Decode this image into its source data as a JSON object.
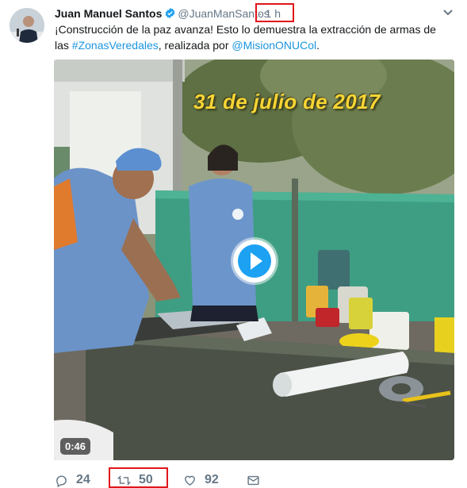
{
  "author": {
    "name": "Juan Manuel Santos",
    "handle": "@JuanManSantos",
    "time": "· 1 h"
  },
  "tweet": {
    "text_part1": "¡Construcción de la paz avanza! Esto lo demuestra la extracción de armas de las ",
    "hashtag": "#ZonasVeredales",
    "text_part2": ", realizada por ",
    "mention": "@MisionONUCol",
    "text_part3": "."
  },
  "media": {
    "overlay_date": "31 de julio de 2017",
    "duration": "0:46"
  },
  "actions": {
    "replies": "24",
    "retweets": "50",
    "likes": "92"
  },
  "colors": {
    "link": "#1b95e0",
    "highlight": "#e0151b",
    "muted": "#657786"
  },
  "icons": [
    "verified-icon",
    "caret-down-icon",
    "reply-icon",
    "retweet-icon",
    "like-icon",
    "dm-icon",
    "play-icon"
  ]
}
